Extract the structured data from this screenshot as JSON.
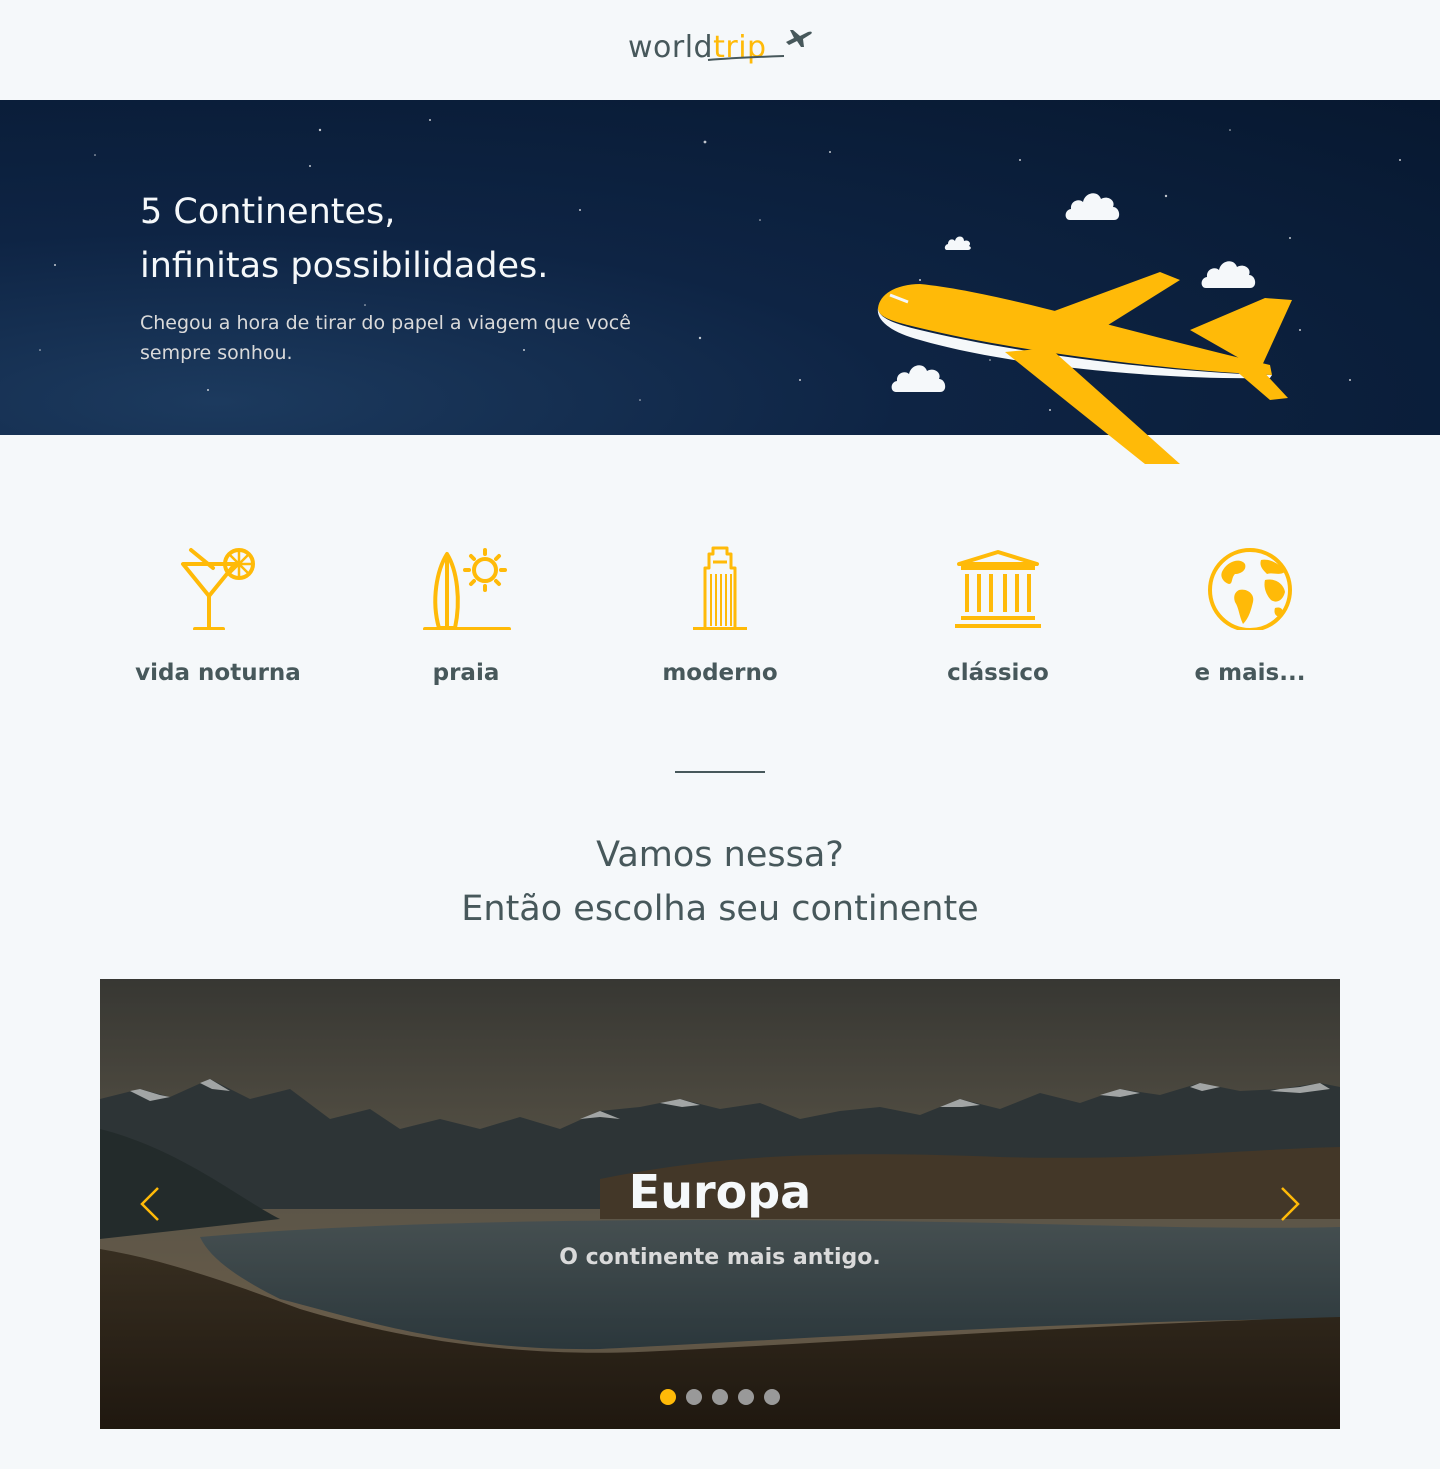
{
  "header": {
    "logo_word": "world",
    "logo_accent": "trip"
  },
  "banner": {
    "title_line1": "5 Continentes,",
    "title_line2": "infinitas possibilidades.",
    "subtitle": "Chegou a hora de tirar do papel a viagem que você sempre sonhou."
  },
  "travel_types": [
    {
      "label": "vida noturna",
      "icon": "cocktail-icon"
    },
    {
      "label": "praia",
      "icon": "surf-sun-icon"
    },
    {
      "label": "moderno",
      "icon": "building-icon"
    },
    {
      "label": "clássico",
      "icon": "museum-icon"
    },
    {
      "label": "e mais...",
      "icon": "earth-icon"
    }
  ],
  "cta": {
    "line1": "Vamos nessa?",
    "line2": "Então escolha seu continente"
  },
  "carousel": {
    "slide_title": "Europa",
    "slide_subtitle": "O continente mais antigo.",
    "active_index": 0,
    "slide_count": 5
  },
  "colors": {
    "accent": "#FFBA08",
    "heading": "#47585B",
    "background": "#F5F8FA",
    "light": "#F5F8FA",
    "muted": "#999999"
  }
}
